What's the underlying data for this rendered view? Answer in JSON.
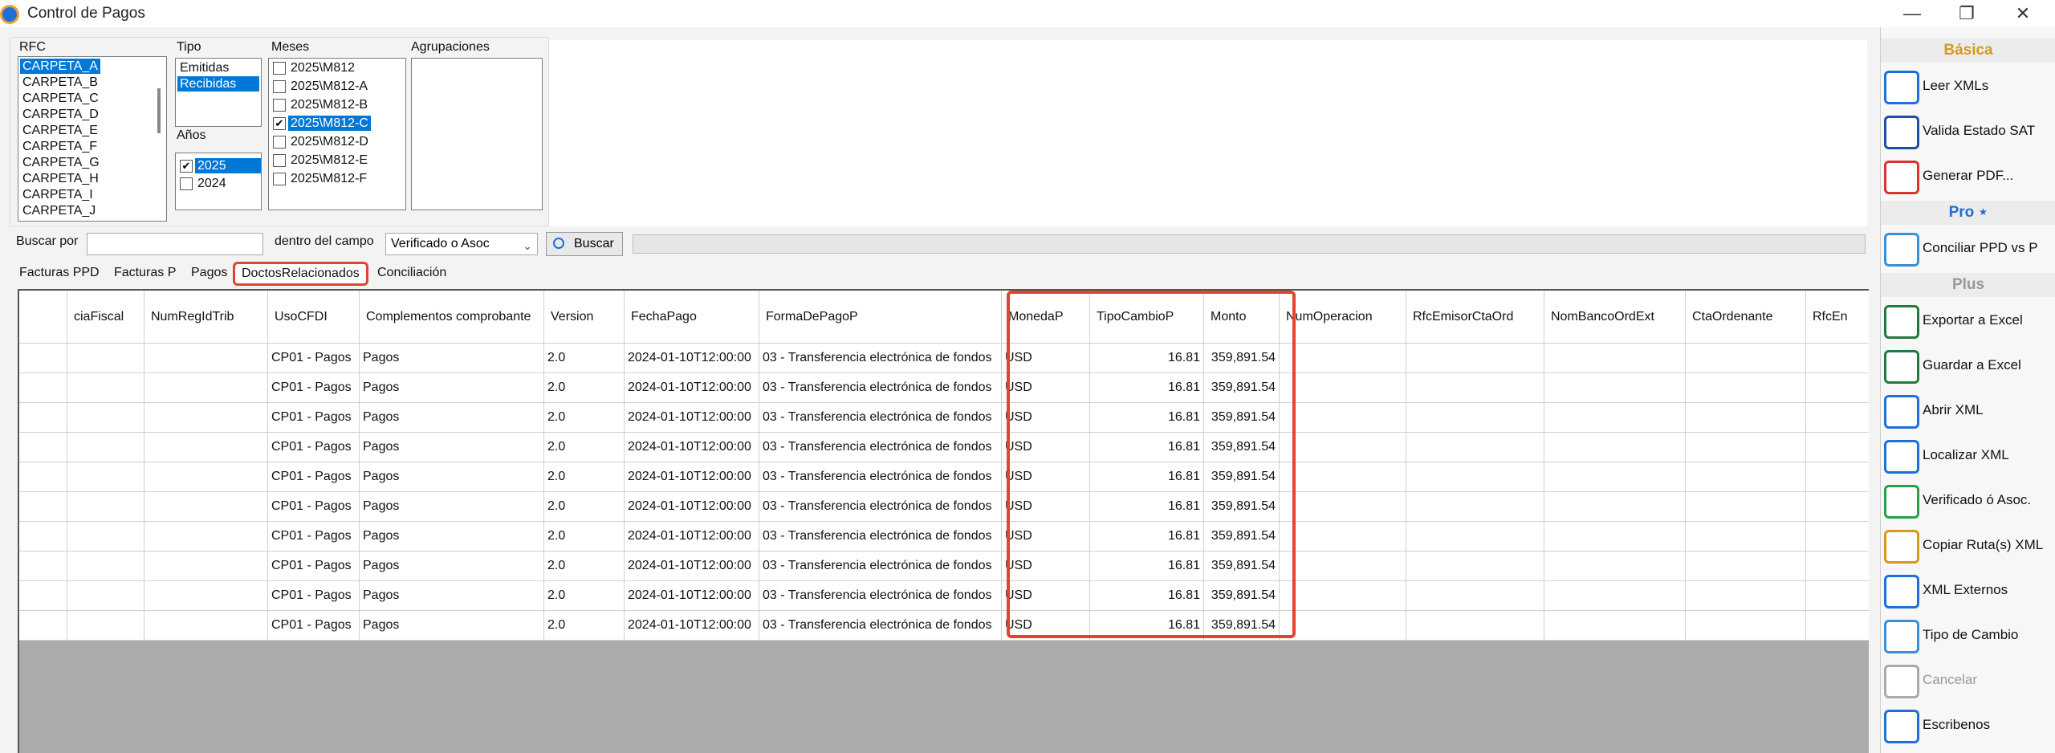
{
  "window": {
    "title": "Control de Pagos",
    "min": "—",
    "restore": "❐",
    "close": "✕"
  },
  "filters": {
    "rfc_label": "RFC",
    "rfc_items": [
      "CARPETA_A",
      "CARPETA_B",
      "CARPETA_C",
      "CARPETA_D",
      "CARPETA_E",
      "CARPETA_F",
      "CARPETA_G",
      "CARPETA_H",
      "CARPETA_I",
      "CARPETA_J"
    ],
    "rfc_selected": 0,
    "tipo_label": "Tipo",
    "tipo_items": [
      "Emitidas",
      "Recibidas"
    ],
    "tipo_selected": 1,
    "anios_label": "Años",
    "anios_items": [
      {
        "label": "2025",
        "checked": true,
        "selected": true
      },
      {
        "label": "2024",
        "checked": false,
        "selected": false
      }
    ],
    "meses_label": "Meses",
    "meses_items": [
      {
        "label": "2025\\M812",
        "checked": false,
        "selected": false
      },
      {
        "label": "2025\\M812-A",
        "checked": false,
        "selected": false
      },
      {
        "label": "2025\\M812-B",
        "checked": false,
        "selected": false
      },
      {
        "label": "2025\\M812-C",
        "checked": true,
        "selected": true
      },
      {
        "label": "2025\\M812-D",
        "checked": false,
        "selected": false
      },
      {
        "label": "2025\\M812-E",
        "checked": false,
        "selected": false
      },
      {
        "label": "2025\\M812-F",
        "checked": false,
        "selected": false
      }
    ],
    "agrupaciones_label": "Agrupaciones"
  },
  "search": {
    "buscar_por_label": "Buscar por",
    "buscar_por_value": "",
    "dentro_label": "dentro del campo",
    "campo_value": "Verificado o Asoc",
    "buscar_button": "Buscar"
  },
  "tabs": [
    {
      "label": "Facturas PPD",
      "active": false
    },
    {
      "label": "Facturas P",
      "active": false
    },
    {
      "label": "Pagos",
      "active": false
    },
    {
      "label": "DoctosRelacionados",
      "active": true
    },
    {
      "label": "Conciliación",
      "active": false
    }
  ],
  "grid": {
    "columns": [
      "",
      "ciaFiscal",
      "NumRegIdTrib",
      "UsoCFDI",
      "Complementos comprobante",
      "Version",
      "FechaPago",
      "FormaDePagoP",
      "MonedaP",
      "TipoCambioP",
      "Monto",
      "NumOperacion",
      "RfcEmisorCtaOrd",
      "NomBancoOrdExt",
      "CtaOrdenante",
      "RfcEn"
    ],
    "rows": [
      [
        "",
        "",
        "",
        "CP01 - Pagos",
        "Pagos",
        "2.0",
        "2024-01-10T12:00:00",
        "03 - Transferencia electrónica de fondos",
        "USD",
        "16.81",
        "359,891.54",
        "",
        "",
        "",
        "",
        ""
      ],
      [
        "",
        "",
        "",
        "CP01 - Pagos",
        "Pagos",
        "2.0",
        "2024-01-10T12:00:00",
        "03 - Transferencia electrónica de fondos",
        "USD",
        "16.81",
        "359,891.54",
        "",
        "",
        "",
        "",
        ""
      ],
      [
        "",
        "",
        "",
        "CP01 - Pagos",
        "Pagos",
        "2.0",
        "2024-01-10T12:00:00",
        "03 - Transferencia electrónica de fondos",
        "USD",
        "16.81",
        "359,891.54",
        "",
        "",
        "",
        "",
        ""
      ],
      [
        "",
        "",
        "",
        "CP01 - Pagos",
        "Pagos",
        "2.0",
        "2024-01-10T12:00:00",
        "03 - Transferencia electrónica de fondos",
        "USD",
        "16.81",
        "359,891.54",
        "",
        "",
        "",
        "",
        ""
      ],
      [
        "",
        "",
        "",
        "CP01 - Pagos",
        "Pagos",
        "2.0",
        "2024-01-10T12:00:00",
        "03 - Transferencia electrónica de fondos",
        "USD",
        "16.81",
        "359,891.54",
        "",
        "",
        "",
        "",
        ""
      ],
      [
        "",
        "",
        "",
        "CP01 - Pagos",
        "Pagos",
        "2.0",
        "2024-01-10T12:00:00",
        "03 - Transferencia electrónica de fondos",
        "USD",
        "16.81",
        "359,891.54",
        "",
        "",
        "",
        "",
        ""
      ],
      [
        "",
        "",
        "",
        "CP01 - Pagos",
        "Pagos",
        "2.0",
        "2024-01-10T12:00:00",
        "03 - Transferencia electrónica de fondos",
        "USD",
        "16.81",
        "359,891.54",
        "",
        "",
        "",
        "",
        ""
      ],
      [
        "",
        "",
        "",
        "CP01 - Pagos",
        "Pagos",
        "2.0",
        "2024-01-10T12:00:00",
        "03 - Transferencia electrónica de fondos",
        "USD",
        "16.81",
        "359,891.54",
        "",
        "",
        "",
        "",
        ""
      ],
      [
        "",
        "",
        "",
        "CP01 - Pagos",
        "Pagos",
        "2.0",
        "2024-01-10T12:00:00",
        "03 - Transferencia electrónica de fondos",
        "USD",
        "16.81",
        "359,891.54",
        "",
        "",
        "",
        "",
        ""
      ],
      [
        "",
        "",
        "",
        "CP01 - Pagos",
        "Pagos",
        "2.0",
        "2024-01-10T12:00:00",
        "03 - Transferencia electrónica de fondos",
        "USD",
        "16.81",
        "359,891.54",
        "",
        "",
        "",
        "",
        ""
      ]
    ]
  },
  "sidebar": {
    "basica_title": "Básica",
    "pro_title": "Pro ⋆",
    "plus_title": "Plus",
    "basica": [
      {
        "label": "Leer XMLs",
        "icon": "folder-search-icon",
        "color": "#1e6fd9"
      },
      {
        "label": "Valida Estado SAT",
        "icon": "sat-icon",
        "color": "#1e4fa0"
      },
      {
        "label": "Generar PDF...",
        "icon": "pdf-icon",
        "color": "#d9342b"
      }
    ],
    "pro": [
      {
        "label": "Conciliar PPD vs P",
        "icon": "list-icon",
        "color": "#3a8fd9"
      }
    ],
    "plus": [
      {
        "label": "Exportar a Excel",
        "icon": "excel-export-icon",
        "color": "#1f7a3e",
        "disabled": false
      },
      {
        "label": "Guardar a Excel",
        "icon": "excel-save-icon",
        "color": "#1f7a3e",
        "disabled": false
      },
      {
        "label": "Abrir XML",
        "icon": "xml-open-icon",
        "color": "#1e6fd9",
        "disabled": false
      },
      {
        "label": "Localizar  XML",
        "icon": "xml-search-icon",
        "color": "#1e6fd9",
        "disabled": false
      },
      {
        "label": "Verificado ó Asoc.",
        "icon": "check-icon",
        "color": "#2a9d4a",
        "disabled": false
      },
      {
        "label": "Copiar Ruta(s) XML",
        "icon": "copy-path-icon",
        "color": "#d69a1a",
        "disabled": false
      },
      {
        "label": "XML Externos",
        "icon": "xml-external-icon",
        "color": "#1e6fd9",
        "disabled": false
      },
      {
        "label": "Tipo de Cambio",
        "icon": "exchange-icon",
        "color": "#3a8fd9",
        "disabled": false
      },
      {
        "label": "Cancelar",
        "icon": "cancel-icon",
        "color": "#aaaaaa",
        "disabled": true
      },
      {
        "label": "Escribenos",
        "icon": "contact-icon",
        "color": "#1e6fd9",
        "disabled": false
      }
    ]
  },
  "colors": {
    "highlight": "#e0452d",
    "selection": "#0078d7",
    "grid_empty": "#ababab"
  }
}
